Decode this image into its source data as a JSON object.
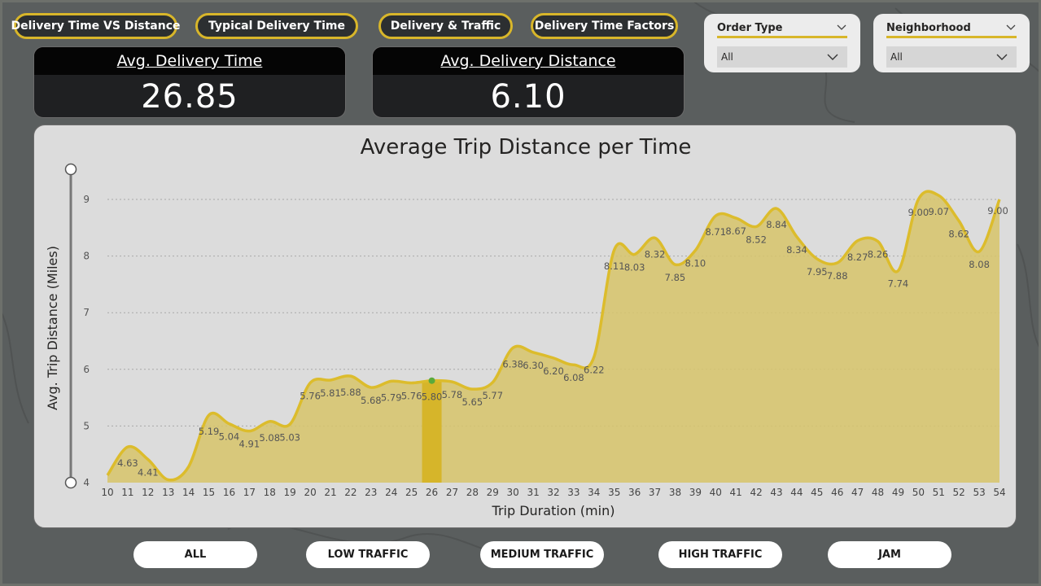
{
  "nav": {
    "buttons": [
      {
        "label": "Delivery Time VS Distance"
      },
      {
        "label": "Typical Delivery Time"
      },
      {
        "label": "Delivery & Traffic"
      },
      {
        "label": "Delivery Time Factors"
      }
    ]
  },
  "kpis": [
    {
      "title": "Avg. Delivery Time",
      "value": "26.85"
    },
    {
      "title": "Avg. Delivery Distance",
      "value": "6.10"
    }
  ],
  "slicers": [
    {
      "title": "Order Type",
      "selected": "All"
    },
    {
      "title": "Neighborhood",
      "selected": "All"
    }
  ],
  "traffic_filters": [
    "ALL",
    "LOW TRAFFIC",
    "MEDIUM TRAFFIC",
    "HIGH TRAFFIC",
    "JAM"
  ],
  "colors": {
    "accent": "#d8b62a",
    "line": "#dcbc2c",
    "area": "#d7c46a",
    "highlight_bar": "#d6b52a",
    "highlight_dot": "#5aaa3c"
  },
  "chart_data": {
    "type": "area",
    "title": "Average Trip Distance per Time",
    "xlabel": "Trip Duration (min)",
    "ylabel": "Avg. Trip Distance (Miles)",
    "x": [
      10,
      11,
      12,
      13,
      14,
      15,
      16,
      17,
      18,
      19,
      20,
      21,
      22,
      23,
      24,
      25,
      26,
      27,
      28,
      29,
      30,
      31,
      32,
      33,
      34,
      35,
      36,
      37,
      38,
      39,
      40,
      41,
      42,
      43,
      44,
      45,
      46,
      47,
      48,
      49,
      50,
      51,
      52,
      53,
      54
    ],
    "values": [
      4.13,
      4.63,
      4.41,
      4.05,
      4.28,
      5.19,
      5.04,
      4.91,
      5.08,
      5.03,
      5.76,
      5.81,
      5.88,
      5.68,
      5.79,
      5.76,
      5.8,
      5.78,
      5.65,
      5.77,
      6.38,
      6.3,
      6.2,
      6.08,
      6.22,
      8.11,
      8.03,
      8.32,
      7.85,
      8.1,
      8.71,
      8.67,
      8.52,
      8.84,
      8.34,
      7.95,
      7.88,
      8.27,
      8.26,
      7.74,
      9.0,
      9.07,
      8.62,
      8.08,
      9.0
    ],
    "data_labels": {
      "11": "4.63",
      "12": "4.41",
      "15": "5.19",
      "16": "5.04",
      "17": "4.91",
      "18": "5.08",
      "19": "5.03",
      "20": "5.76",
      "21": "5.81",
      "22": "5.88",
      "23": "5.68",
      "24": "5.79",
      "25": "5.76",
      "26": "5.80",
      "27": "5.78",
      "28": "5.65",
      "29": "5.77",
      "30": "6.38",
      "31": "6.30",
      "32": "6.20",
      "33": "6.08",
      "34": "6.22",
      "35": "8.11",
      "36": "8.03",
      "37": "8.32",
      "38": "7.85",
      "39": "8.10",
      "40": "8.71",
      "41": "8.67",
      "42": "8.52",
      "43": "8.84",
      "44": "8.34",
      "45": "7.95",
      "46": "7.88",
      "47": "8.27",
      "48": "8.26",
      "49": "7.74",
      "50": "9.00",
      "51": "9.07",
      "52": "8.62",
      "53": "8.08",
      "54": "9.00"
    },
    "highlighted_x": 26,
    "ylim": [
      4,
      9
    ],
    "yticks": [
      4,
      5,
      6,
      7,
      8,
      9
    ],
    "grid": true,
    "legend": "none"
  }
}
